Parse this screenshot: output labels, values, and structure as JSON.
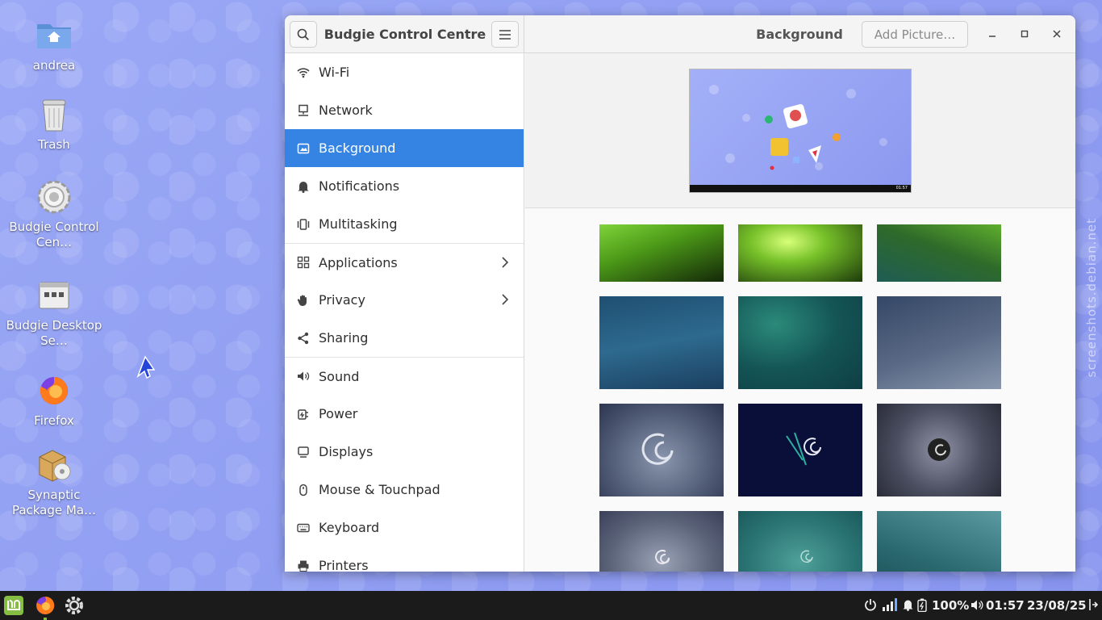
{
  "desktop": {
    "icons": [
      {
        "label": "andrea",
        "icon": "home-folder-icon"
      },
      {
        "label": "Trash",
        "icon": "trash-icon"
      },
      {
        "label": "Budgie Control Cen…",
        "icon": "gear-icon"
      },
      {
        "label": "Budgie Desktop Se…",
        "icon": "settings-app-icon"
      },
      {
        "label": "Firefox",
        "icon": "firefox-icon"
      },
      {
        "label": "Synaptic Package Ma…",
        "icon": "package-icon"
      }
    ],
    "watermark": "screenshots.debian.net"
  },
  "window": {
    "app_title": "Budgie Control Centre",
    "panel_title": "Background",
    "add_button": "Add Picture…"
  },
  "sidebar": {
    "items": [
      {
        "label": "Wi-Fi",
        "icon": "wifi-icon"
      },
      {
        "label": "Network",
        "icon": "network-icon"
      },
      {
        "label": "Background",
        "icon": "background-icon",
        "active": true
      },
      {
        "label": "Notifications",
        "icon": "bell-icon"
      },
      {
        "label": "Multitasking",
        "icon": "multitasking-icon"
      },
      {
        "label": "Applications",
        "icon": "apps-grid-icon"
      },
      {
        "label": "Privacy",
        "icon": "hand-icon"
      },
      {
        "label": "Sharing",
        "icon": "share-icon"
      },
      {
        "label": "Sound",
        "icon": "speaker-icon"
      },
      {
        "label": "Power",
        "icon": "power-plug-icon"
      },
      {
        "label": "Displays",
        "icon": "display-icon"
      },
      {
        "label": "Mouse & Touchpad",
        "icon": "mouse-icon"
      },
      {
        "label": "Keyboard",
        "icon": "keyboard-icon"
      },
      {
        "label": "Printers",
        "icon": "printer-icon"
      }
    ]
  },
  "preview": {
    "clock": "01:57"
  },
  "taskbar": {
    "battery": "100%",
    "time": "01:57",
    "date": "23/08/25"
  },
  "colors": {
    "accent": "#3584e4",
    "panel": "#1b1b1b"
  }
}
